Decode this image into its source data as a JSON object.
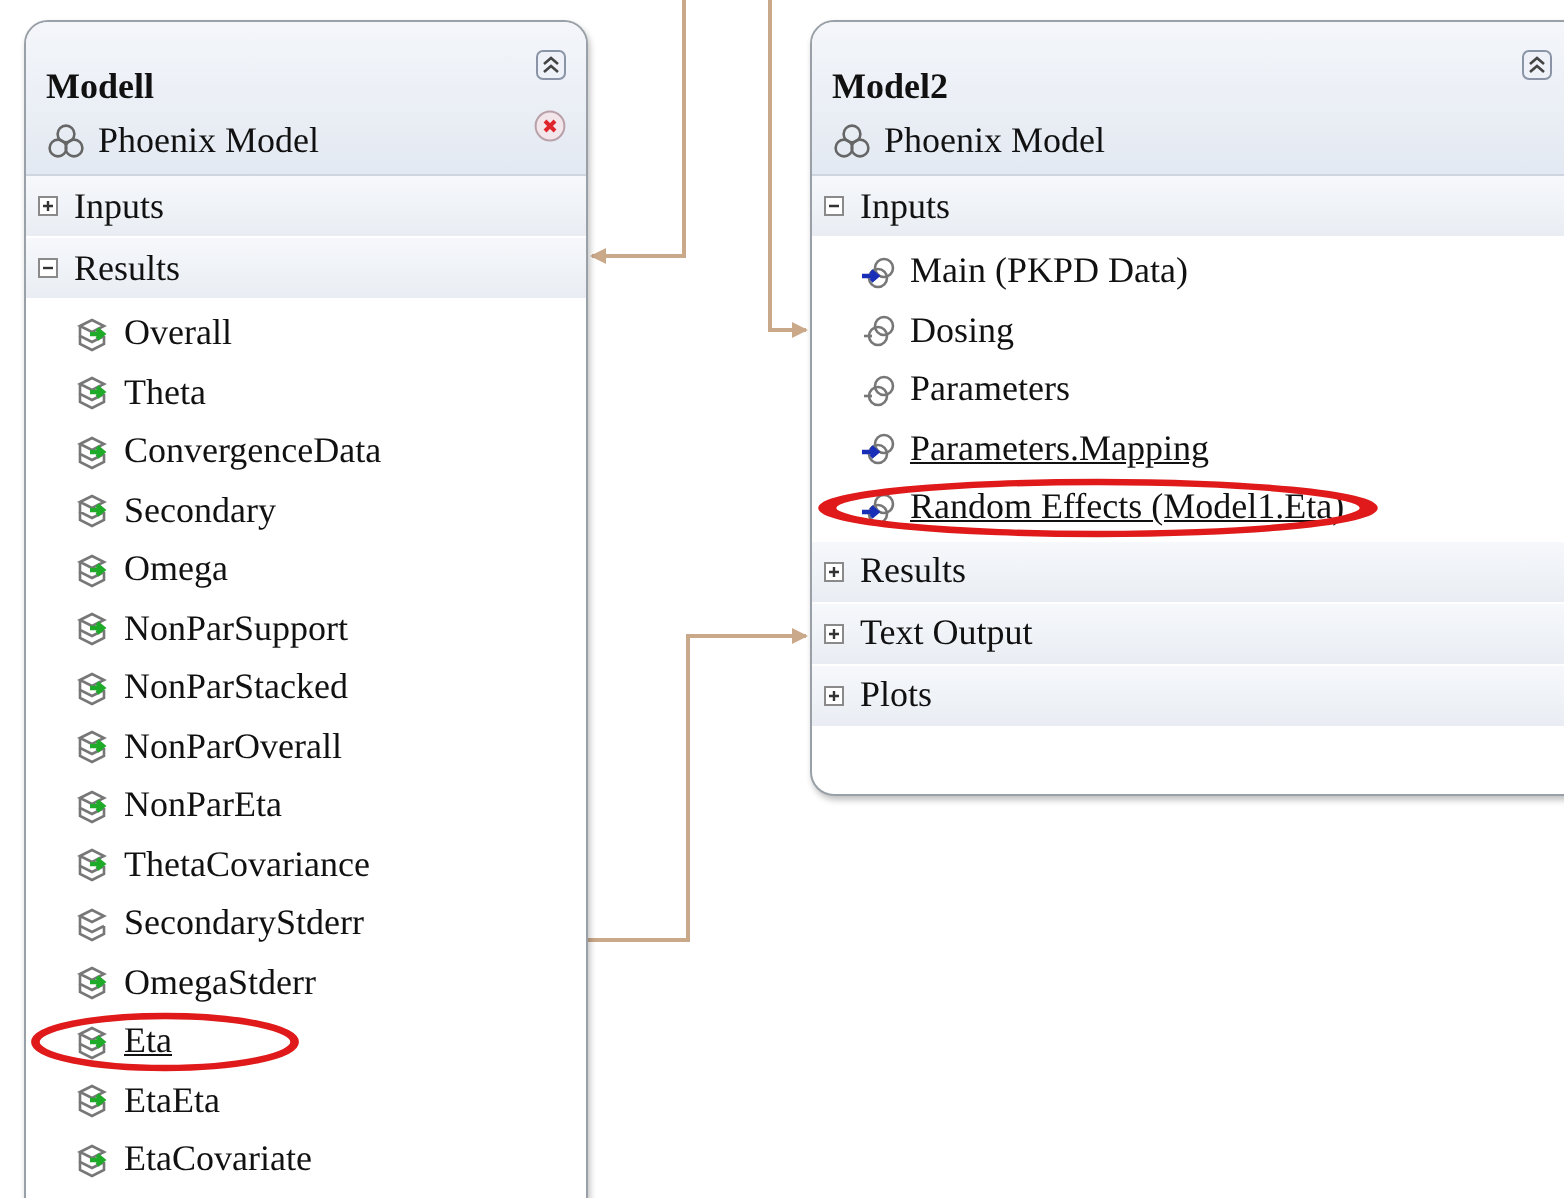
{
  "panels": [
    {
      "title": "Modell",
      "subtitle": "Phoenix Model",
      "closable": true,
      "sections": [
        {
          "label": "Inputs",
          "expanded": false
        },
        {
          "label": "Results",
          "expanded": true,
          "items": [
            {
              "label": "Overall",
              "kind": "result",
              "arrow": true,
              "underlined": false,
              "circled": false
            },
            {
              "label": "Theta",
              "kind": "result",
              "arrow": true,
              "underlined": false,
              "circled": false
            },
            {
              "label": "ConvergenceData",
              "kind": "result",
              "arrow": true,
              "underlined": false,
              "circled": false
            },
            {
              "label": "Secondary",
              "kind": "result",
              "arrow": true,
              "underlined": false,
              "circled": false
            },
            {
              "label": "Omega",
              "kind": "result",
              "arrow": true,
              "underlined": false,
              "circled": false
            },
            {
              "label": "NonParSupport",
              "kind": "result",
              "arrow": true,
              "underlined": false,
              "circled": false
            },
            {
              "label": "NonParStacked",
              "kind": "result",
              "arrow": true,
              "underlined": false,
              "circled": false
            },
            {
              "label": "NonParOverall",
              "kind": "result",
              "arrow": true,
              "underlined": false,
              "circled": false
            },
            {
              "label": "NonParEta",
              "kind": "result",
              "arrow": true,
              "underlined": false,
              "circled": false
            },
            {
              "label": "ThetaCovariance",
              "kind": "result",
              "arrow": true,
              "underlined": false,
              "circled": false
            },
            {
              "label": "SecondaryStderr",
              "kind": "result",
              "arrow": false,
              "underlined": false,
              "circled": false
            },
            {
              "label": "OmegaStderr",
              "kind": "result",
              "arrow": true,
              "underlined": false,
              "circled": false
            },
            {
              "label": "Eta",
              "kind": "result",
              "arrow": true,
              "underlined": true,
              "circled": true
            },
            {
              "label": "EtaEta",
              "kind": "result",
              "arrow": true,
              "underlined": false,
              "circled": false
            },
            {
              "label": "EtaCovariate",
              "kind": "result",
              "arrow": true,
              "underlined": false,
              "circled": false
            }
          ]
        }
      ]
    },
    {
      "title": "Model2",
      "subtitle": "Phoenix Model",
      "closable": false,
      "sections": [
        {
          "label": "Inputs",
          "expanded": true,
          "items": [
            {
              "label": "Main (PKPD Data)",
              "kind": "input",
              "arrow": true,
              "underlined": false,
              "circled": false
            },
            {
              "label": "Dosing",
              "kind": "input",
              "arrow": false,
              "underlined": false,
              "circled": false
            },
            {
              "label": "Parameters",
              "kind": "input",
              "arrow": false,
              "underlined": false,
              "circled": false
            },
            {
              "label": "Parameters.Mapping",
              "kind": "input",
              "arrow": true,
              "underlined": true,
              "circled": false
            },
            {
              "label": "Random Effects (Model1.Eta)",
              "kind": "input",
              "arrow": true,
              "underlined": true,
              "circled": true
            }
          ]
        },
        {
          "label": "Results",
          "expanded": false
        },
        {
          "label": "Text Output",
          "expanded": false
        },
        {
          "label": "Plots",
          "expanded": false
        }
      ]
    }
  ]
}
